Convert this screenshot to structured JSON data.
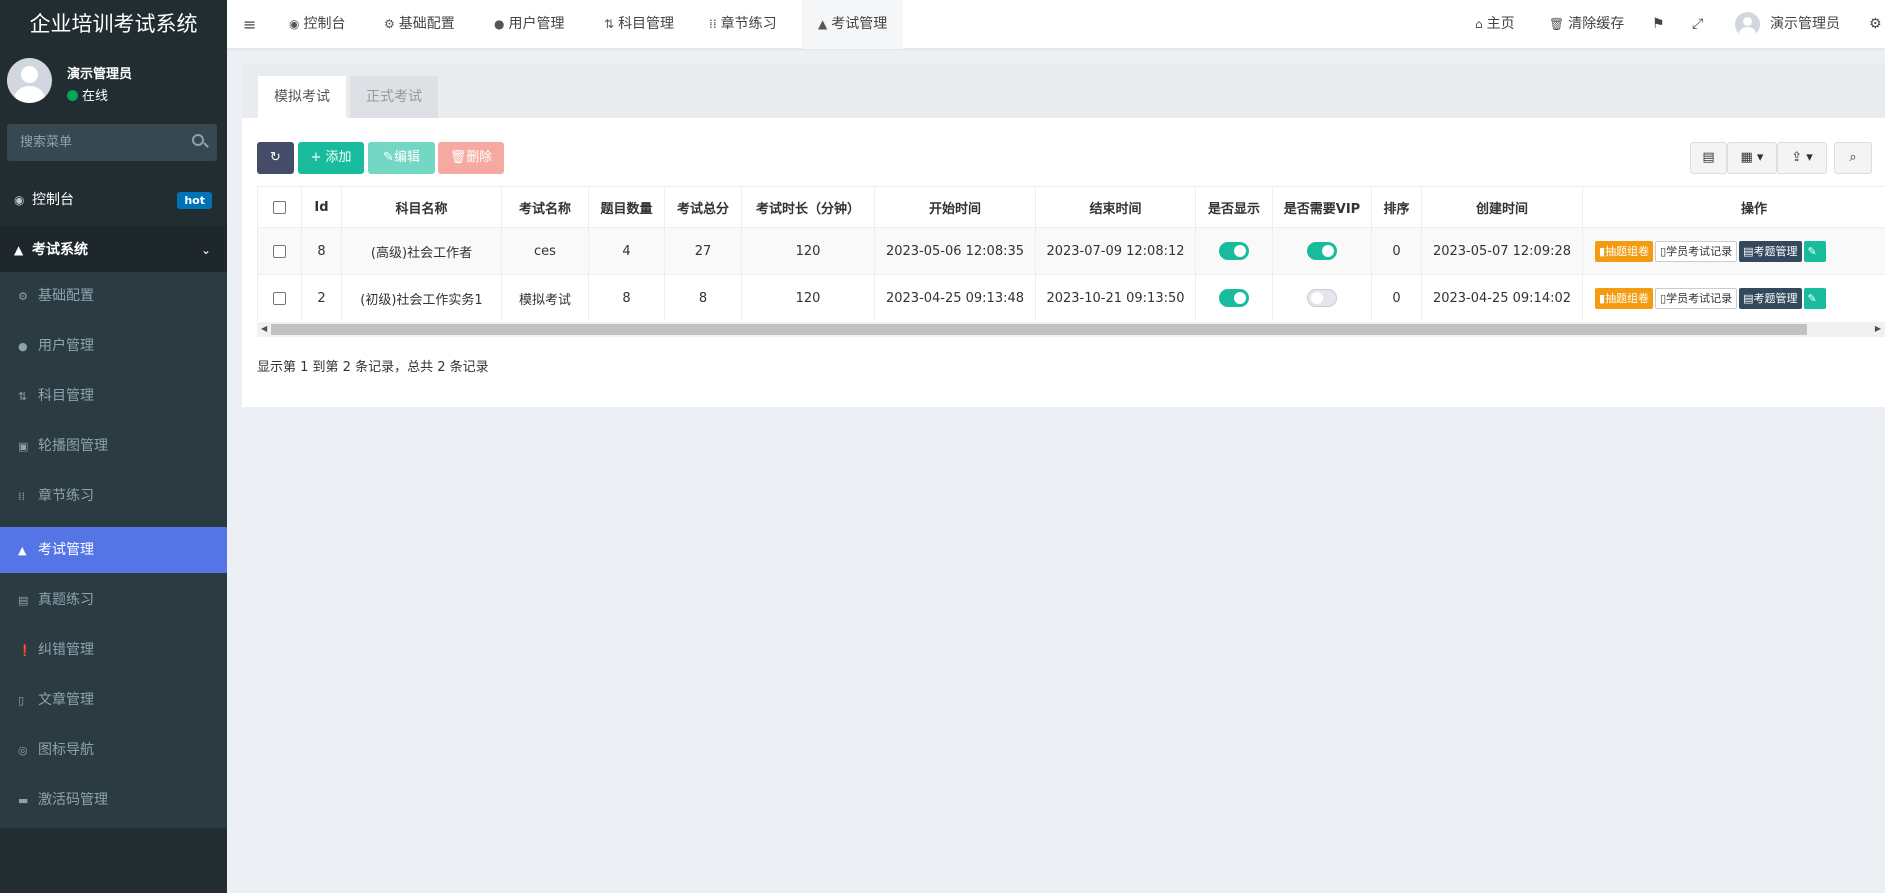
{
  "app": {
    "title": "企业培训考试系统"
  },
  "user": {
    "name": "演示管理员",
    "status": "在线"
  },
  "search": {
    "placeholder": "搜索菜单"
  },
  "sidebar": {
    "dashboard": {
      "label": "控制台",
      "badge": "hot",
      "icon": "dashboard-icon"
    },
    "exam_system": {
      "label": "考试系统",
      "icon": "graduation-cap-icon"
    },
    "items": [
      {
        "label": "基础配置",
        "icon": "gear-icon"
      },
      {
        "label": "用户管理",
        "icon": "user-icon"
      },
      {
        "label": "科目管理",
        "icon": "sort-icon"
      },
      {
        "label": "轮播图管理",
        "icon": "image-icon"
      },
      {
        "label": "章节练习",
        "icon": "th-icon"
      },
      {
        "label": "考试管理",
        "icon": "graduation-cap-icon",
        "active": true
      },
      {
        "label": "真题练习",
        "icon": "list-alt-icon"
      },
      {
        "label": "纠错管理",
        "icon": "exclamation-circle-icon"
      },
      {
        "label": "文章管理",
        "icon": "file-icon"
      },
      {
        "label": "图标导航",
        "icon": "compass-icon"
      },
      {
        "label": "激活码管理",
        "icon": "credit-card-icon"
      }
    ]
  },
  "topnav": {
    "tabs": [
      {
        "label": "控制台",
        "icon": "dashboard-icon"
      },
      {
        "label": "基础配置",
        "icon": "gear-icon"
      },
      {
        "label": "用户管理",
        "icon": "user-icon"
      },
      {
        "label": "科目管理",
        "icon": "sort-icon"
      },
      {
        "label": "章节练习",
        "icon": "th-icon"
      },
      {
        "label": "考试管理",
        "icon": "graduation-cap-icon",
        "active": true
      }
    ],
    "home": "主页",
    "clear_cache": "清除缓存",
    "user": "演示管理员"
  },
  "content_tabs": [
    "模拟考试",
    "正式考试"
  ],
  "toolbar": {
    "add": "添加",
    "edit": "编辑",
    "delete": "删除"
  },
  "table": {
    "headers": [
      "Id",
      "科目名称",
      "考试名称",
      "题目数量",
      "考试总分",
      "考试时长（分钟）",
      "开始时间",
      "结束时间",
      "是否显示",
      "是否需要VIP",
      "排序",
      "创建时间",
      "操作"
    ],
    "rows": [
      {
        "id": "8",
        "subject": "(高级)社会工作者",
        "exam": "ces",
        "count": "4",
        "total": "27",
        "duration": "120",
        "start": "2023-05-06 12:08:35",
        "end": "2023-07-09 12:08:12",
        "show": true,
        "vip": true,
        "sort": "0",
        "created": "2023-05-07 12:09:28"
      },
      {
        "id": "2",
        "subject": "(初级)社会工作实务1",
        "exam": "模拟考试",
        "count": "8",
        "total": "8",
        "duration": "120",
        "start": "2023-04-25 09:13:48",
        "end": "2023-10-21 09:13:50",
        "show": true,
        "vip": false,
        "sort": "0",
        "created": "2023-04-25 09:14:02"
      }
    ],
    "actions": {
      "draw": "抽题组卷",
      "records": "学员考试记录",
      "questions": "考题管理"
    }
  },
  "pagination": {
    "info": "显示第 1 到第 2 条记录，总共 2 条记录"
  },
  "colors": {
    "sidebar": "#222d32",
    "active": "#5575e6",
    "primary": "#18bc9c",
    "danger": "#f39c12"
  }
}
